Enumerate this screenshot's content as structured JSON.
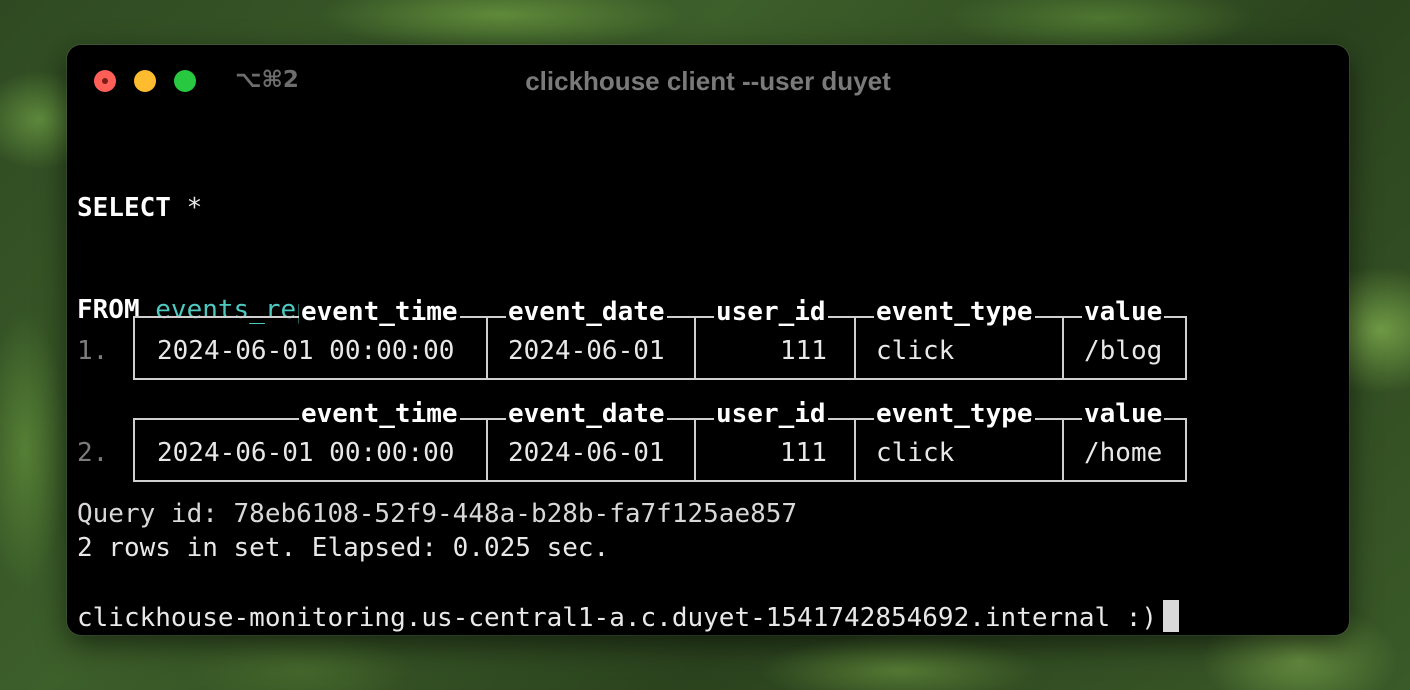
{
  "window": {
    "shortcut": "⌥⌘2",
    "title": "clickhouse client --user duyet"
  },
  "query": {
    "line1_keyword": "SELECT",
    "line1_rest": " *",
    "line2_keyword": "FROM",
    "line2_table": "events_replacing",
    "query_id_line": "Query id: 78eb6108-52f9-448a-b28b-fa7f125ae857"
  },
  "columns": [
    "event_time",
    "event_date",
    "user_id",
    "event_type",
    "value"
  ],
  "rows": [
    {
      "index": "1.",
      "event_time": "2024-06-01 00:00:00",
      "event_date": "2024-06-01",
      "user_id": "111",
      "event_type": "click",
      "value": "/blog"
    },
    {
      "index": "2.",
      "event_time": "2024-06-01 00:00:00",
      "event_date": "2024-06-01",
      "user_id": "111",
      "event_type": "click",
      "value": "/home"
    }
  ],
  "summary": "2 rows in set. Elapsed: 0.025 sec.",
  "prompt": "clickhouse-monitoring.us-central1-a.c.duyet-1541742854692.internal :)",
  "colors": {
    "table_identifier": "#4ec9c0",
    "close_button": "#ff5f57",
    "minimize_button": "#febc2e",
    "maximize_button": "#28c840",
    "background": "#000000"
  }
}
